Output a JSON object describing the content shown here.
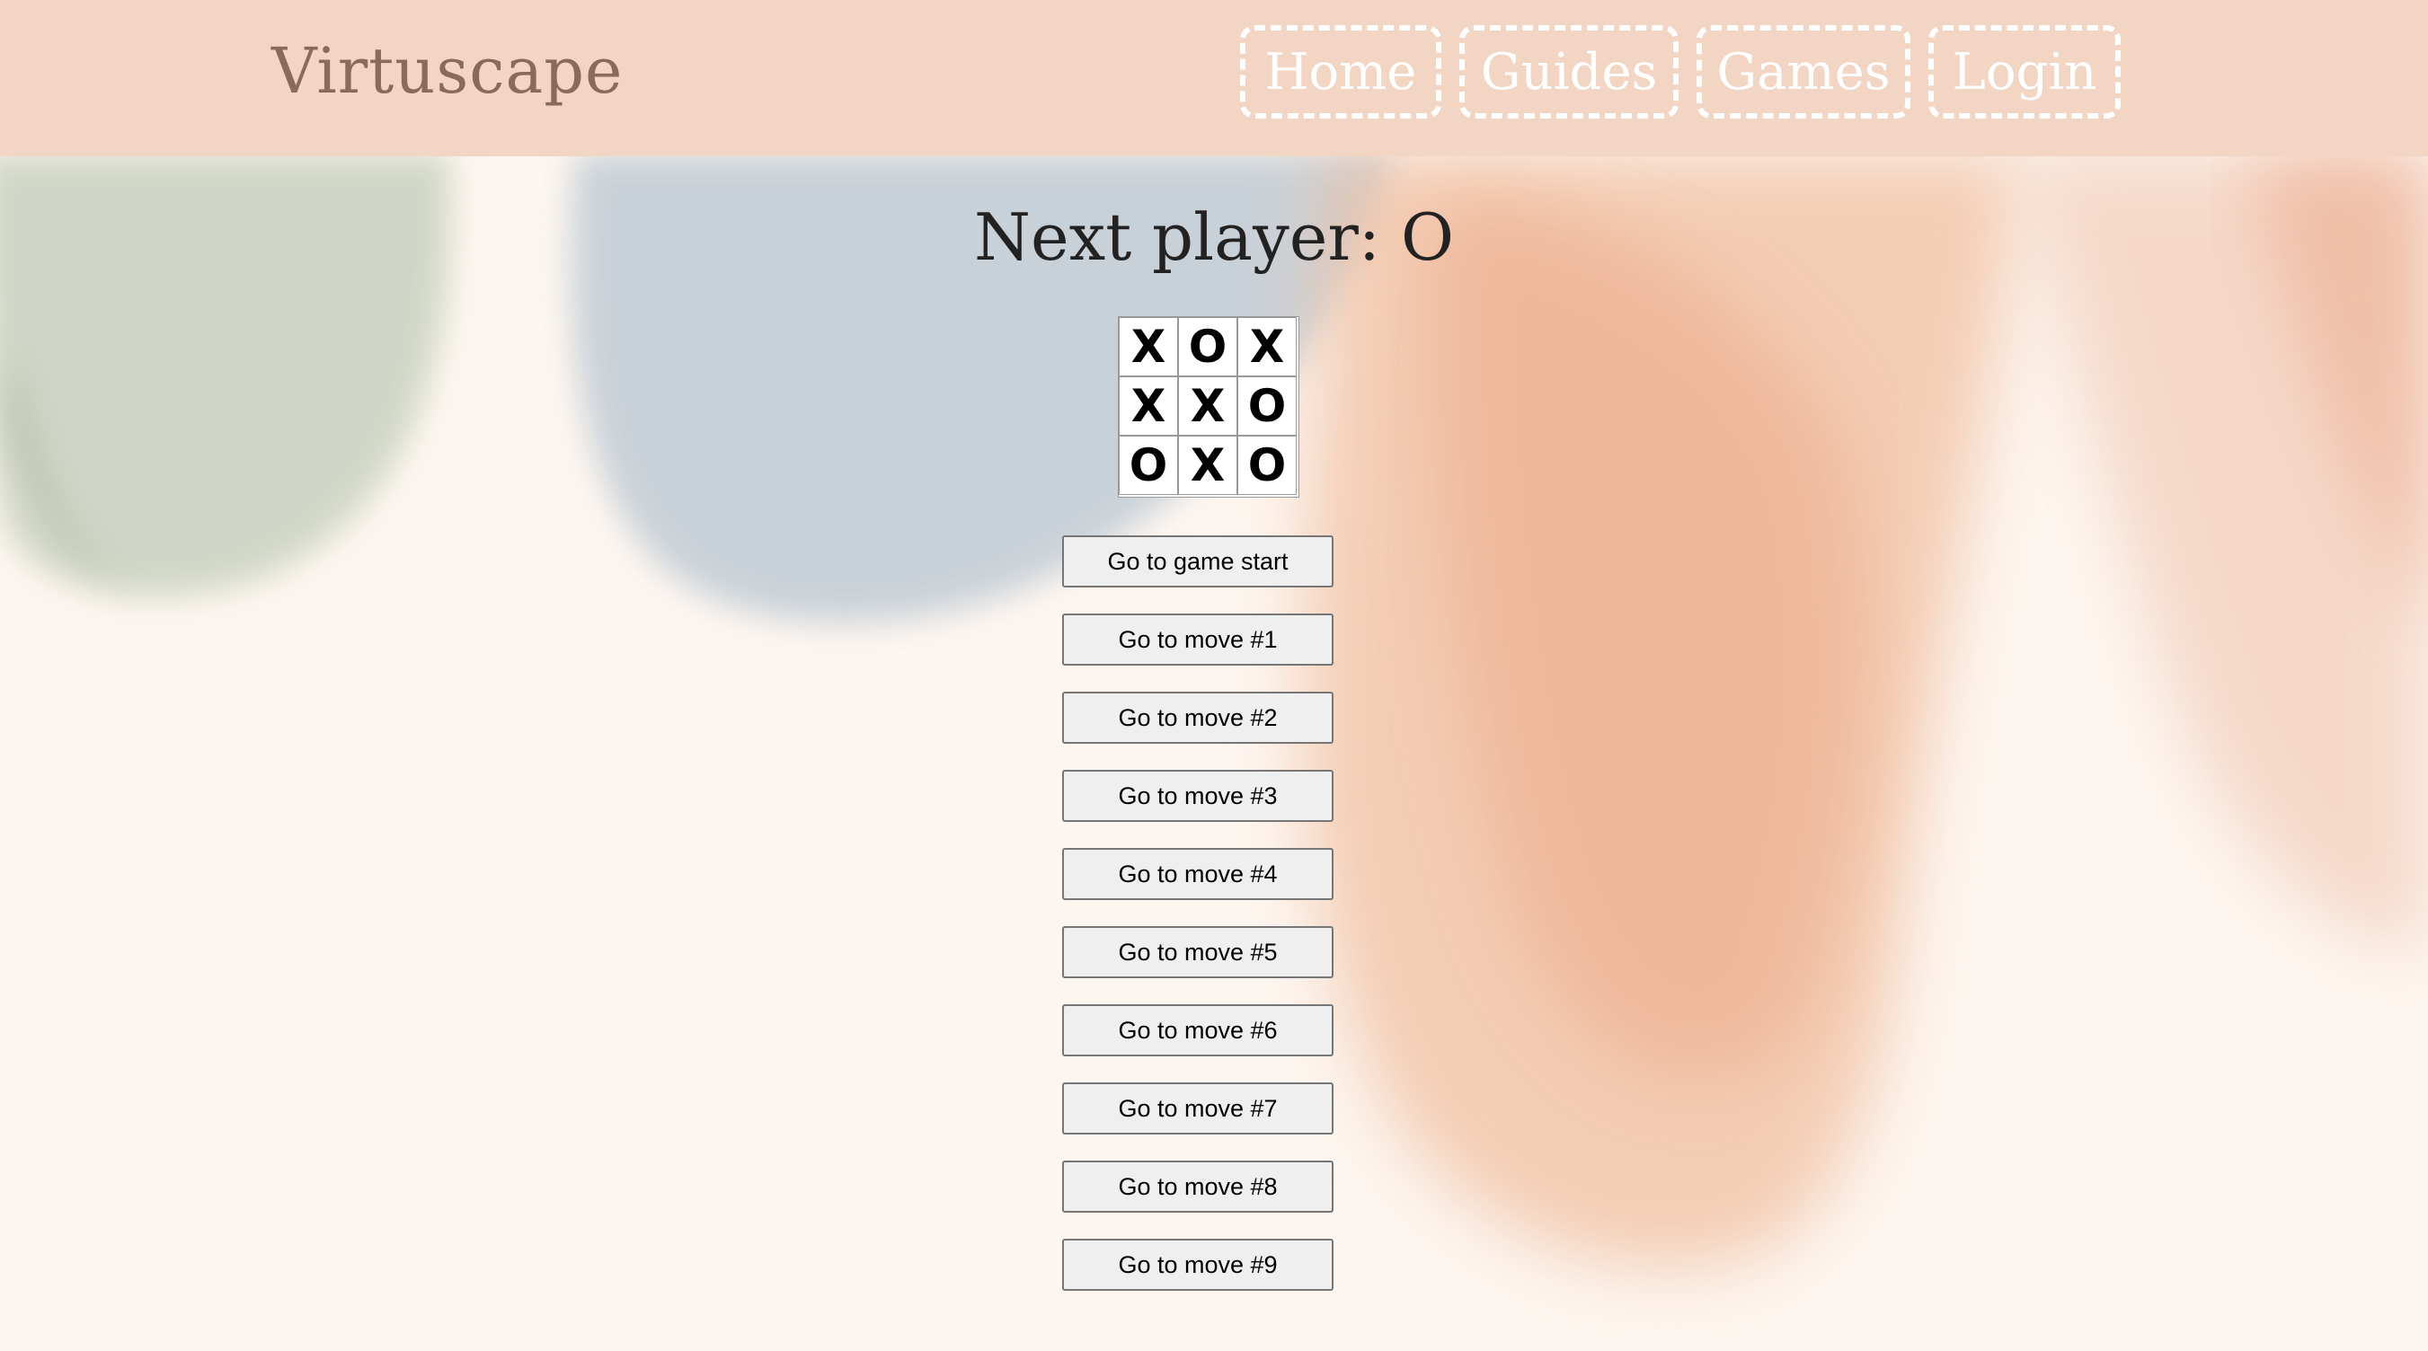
{
  "navbar": {
    "brand": "Virtuscape",
    "links": [
      {
        "label": "Home"
      },
      {
        "label": "Guides"
      },
      {
        "label": "Games"
      },
      {
        "label": "Login"
      }
    ]
  },
  "game": {
    "status": "Next player: O",
    "squares": [
      "X",
      "O",
      "X",
      "X",
      "X",
      "O",
      "O",
      "X",
      "O"
    ],
    "moves": [
      "Go to game start",
      "Go to move #1",
      "Go to move #2",
      "Go to move #3",
      "Go to move #4",
      "Go to move #5",
      "Go to move #6",
      "Go to move #7",
      "Go to move #8",
      "Go to move #9"
    ]
  },
  "colors": {
    "navbar_bg": "#f2d5c2",
    "brand_text": "#8a6a5a",
    "page_bg": "#fdf6f0"
  }
}
